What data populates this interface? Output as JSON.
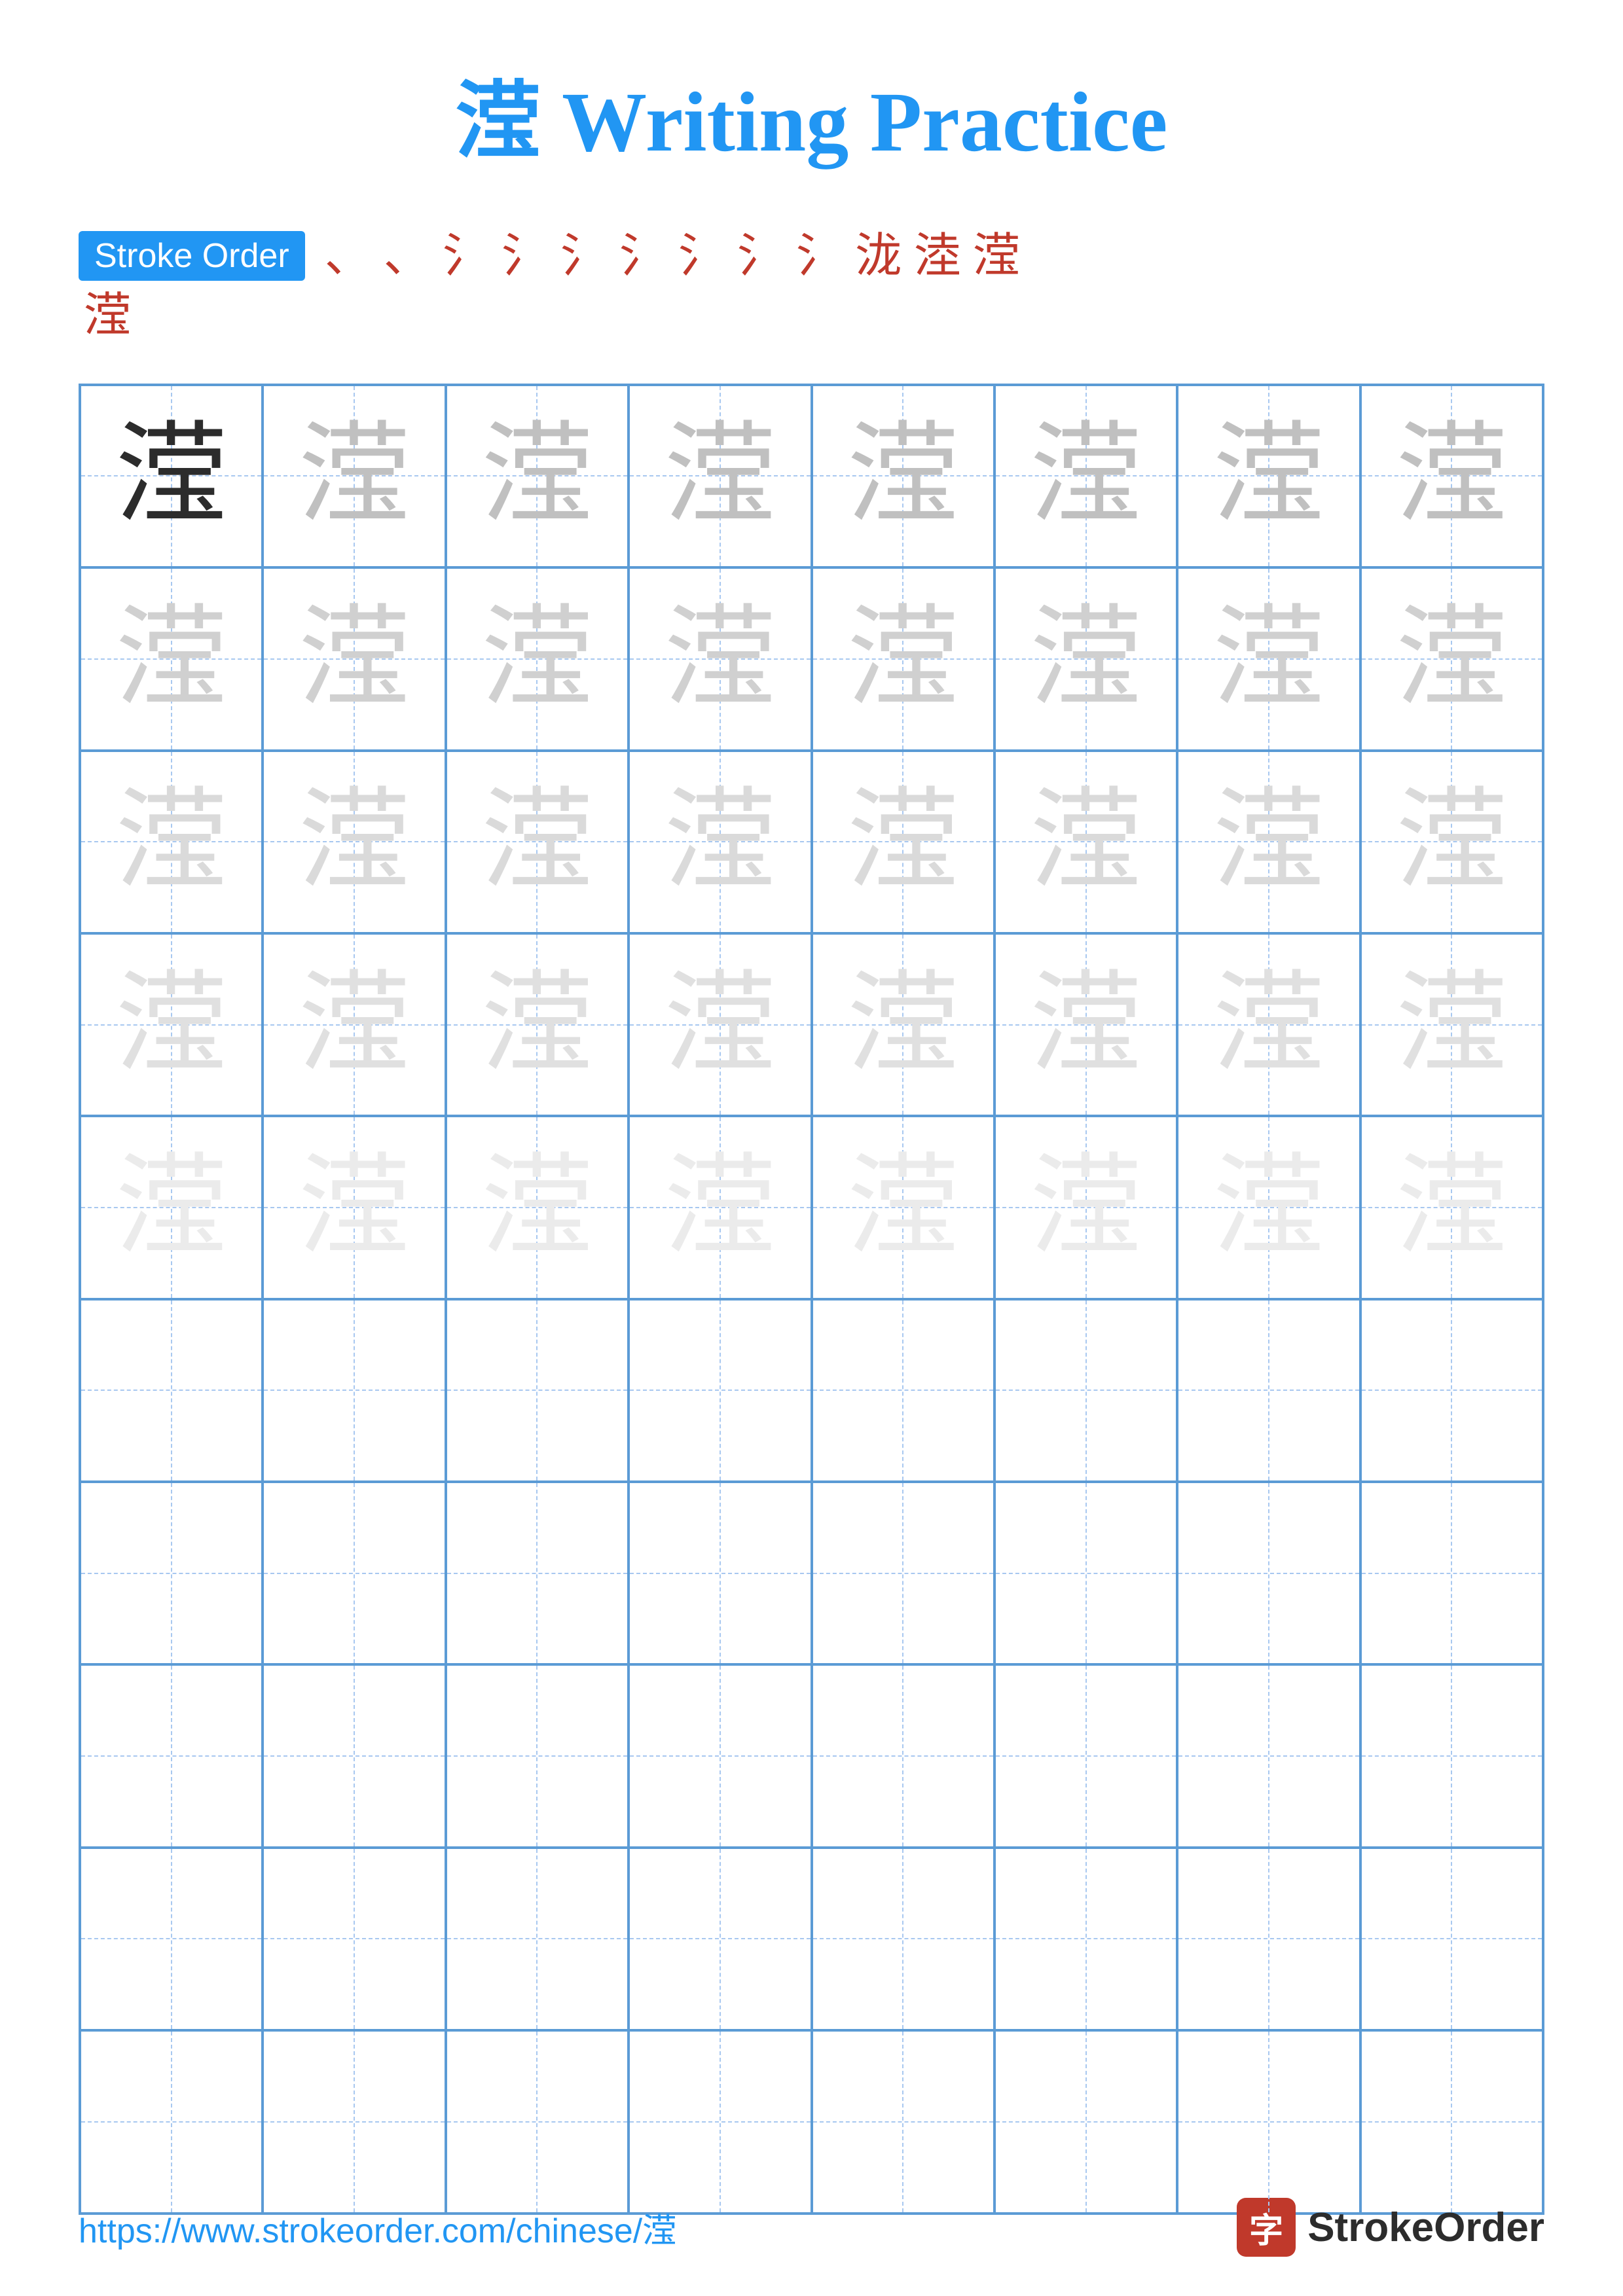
{
  "title": {
    "char": "滢",
    "label": "Writing Practice",
    "full": "滢 Writing Practice"
  },
  "stroke_order": {
    "badge_label": "Stroke Order",
    "strokes_line1": [
      "、",
      "、",
      "氵",
      "氵",
      "氵",
      "氵",
      "氵",
      "氵",
      "氵",
      "泷",
      "淕",
      "滢"
    ],
    "strokes_line2": [
      "滢"
    ]
  },
  "grid": {
    "rows": 10,
    "cols": 8,
    "char": "滢",
    "practice_rows": 5,
    "empty_rows": 5
  },
  "footer": {
    "url": "https://www.strokeorder.com/chinese/滢",
    "brand_name": "StrokeOrder",
    "logo_char": "字"
  },
  "colors": {
    "blue": "#2196F3",
    "red": "#c0392b",
    "grid_border": "#5B9BD5",
    "guide_dash": "#a8c8f0",
    "dark_char": "#2c2c2c",
    "light1": "#bbbbbb",
    "light2": "#c8c8c8",
    "light3": "#d5d5d5",
    "light4": "#e2e2e2",
    "lightest": "#eaeaea"
  }
}
